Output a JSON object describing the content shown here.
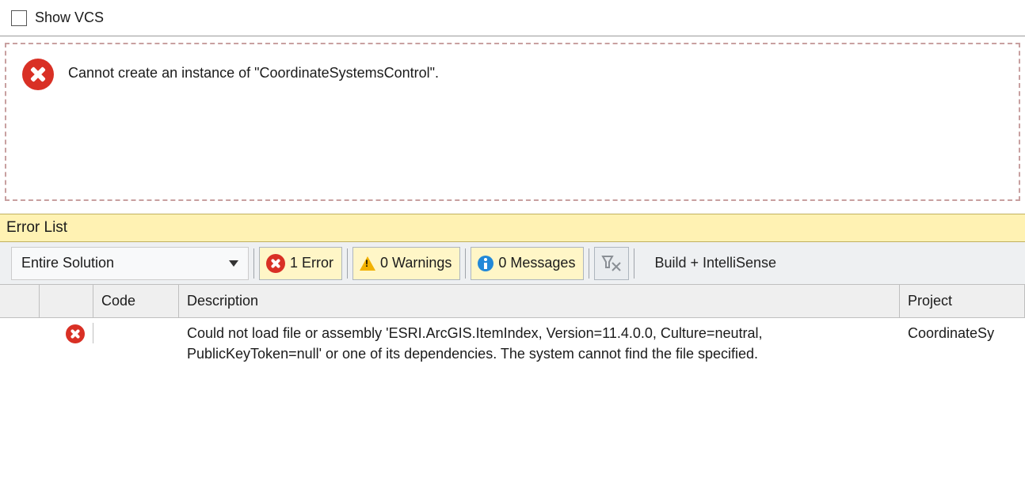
{
  "top": {
    "show_vcs_label": "Show VCS"
  },
  "designer_error": {
    "message": "Cannot create an instance of \"CoordinateSystemsControl\"."
  },
  "error_list": {
    "title": "Error List",
    "scope": "Entire Solution",
    "errors_label": "1 Error",
    "warnings_label": "0 Warnings",
    "messages_label": "0 Messages",
    "build_mode": "Build + IntelliSense",
    "columns": {
      "code": "Code",
      "description": "Description",
      "project": "Project"
    },
    "rows": [
      {
        "severity": "error",
        "code": "",
        "description": "Could not load file or assembly 'ESRI.ArcGIS.ItemIndex, Version=11.4.0.0, Culture=neutral, PublicKeyToken=null' or one of its dependencies. The system cannot find the file specified.",
        "project": "CoordinateSy"
      }
    ]
  }
}
